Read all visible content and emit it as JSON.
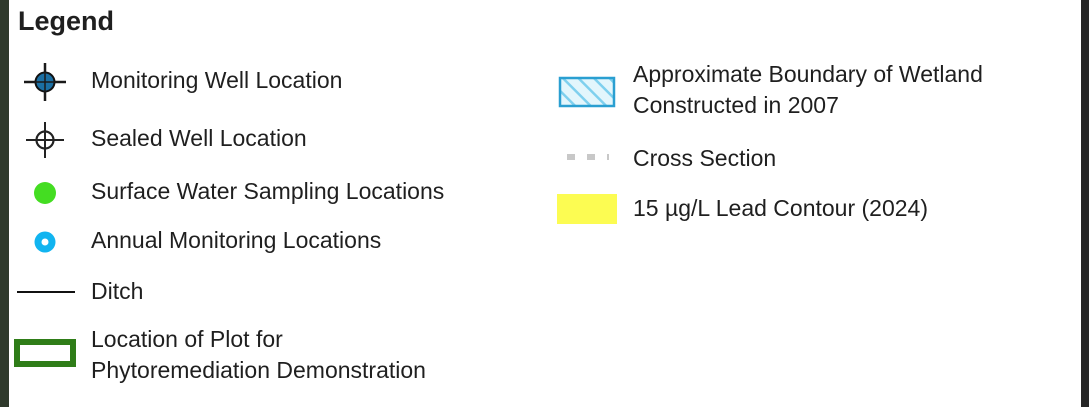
{
  "legend": {
    "title": "Legend",
    "items": [
      {
        "symbol": "monitoring-well-icon",
        "label": "Monitoring Well Location",
        "color": "#1b6fa3"
      },
      {
        "symbol": "sealed-well-icon",
        "label": "Sealed Well Location",
        "color": "#222222"
      },
      {
        "symbol": "green-dot-icon",
        "label": "Surface Water Sampling Locations",
        "color": "#44dd22"
      },
      {
        "symbol": "cyan-ring-icon",
        "label": "Annual Monitoring Locations",
        "color": "#11b4f0"
      },
      {
        "symbol": "line-icon",
        "label": "Ditch",
        "color": "#111111"
      },
      {
        "symbol": "green-rectangle-icon",
        "label_line1": "Location of Plot for",
        "label_line2": "Phytoremediation Demonstration",
        "color": "#2f7d18"
      },
      {
        "symbol": "hatched-rectangle-icon",
        "label_line1": "Approximate Boundary of Wetland",
        "label_line2": "Constructed in 2007",
        "color": "#2a9fd1"
      },
      {
        "symbol": "dashed-line-icon",
        "label": "Cross Section",
        "color": "#c8c8c8"
      },
      {
        "symbol": "yellow-rectangle-icon",
        "label": "15 µg/L Lead Contour (2024)",
        "color": "#fcfc52"
      }
    ]
  }
}
